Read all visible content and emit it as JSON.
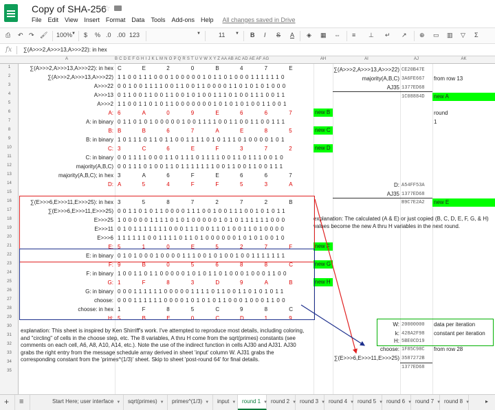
{
  "doc": {
    "title": "Copy of SHA-256",
    "saved_status": "All changes saved in Drive"
  },
  "menu": [
    "File",
    "Edit",
    "View",
    "Insert",
    "Format",
    "Data",
    "Tools",
    "Add-ons",
    "Help"
  ],
  "toolbar": {
    "zoom": "100%",
    "currency": "$",
    "percent": "%",
    "dec_less": ".0",
    "dec_more": ".00",
    "format_more": "123",
    "font_size": "11",
    "bold": "B",
    "italic": "I",
    "strike": "S",
    "text_color": "A"
  },
  "formula": "∑(A>>>2,A>>>13,A>>>22): in hex",
  "columns": {
    "A": "A",
    "cells": "B C D E F G H I J K L M N O P Q R S T U V W X Y Z AA AB AC AD AE AF AG",
    "AH": "AH",
    "AI": "AI",
    "AJ": "AJ",
    "AK": "AK"
  },
  "rows": [
    {
      "n": "1",
      "label": "∑(A>>>2,A>>>13,A>>>22): in hex",
      "hex": [
        "C",
        "",
        "E",
        "",
        "2",
        "",
        "0",
        "",
        "B",
        "",
        "4",
        "",
        "7",
        "",
        "E"
      ]
    },
    {
      "n": "2",
      "label": "∑(A>>>2,A>>>13,A>>>22)",
      "bits": "11001110001000001011010001111110"
    },
    {
      "n": "3",
      "label": "A>>>22",
      "bits": "00100111100110011000011010101000"
    },
    {
      "n": "4",
      "label": "A>>>13",
      "bits": "01100110011001010011101001110011"
    },
    {
      "n": "5",
      "label": "A>>>2",
      "bits": "11001101011000000010101010011001"
    },
    {
      "n": "6",
      "label": "A:",
      "red": true,
      "hex": [
        "6",
        "",
        "A",
        "",
        "0",
        "",
        "9",
        "",
        "E",
        "",
        "6",
        "",
        "6",
        "",
        "7"
      ]
    },
    {
      "n": "7",
      "label": "A: in binary",
      "bits": "01101010000010011110011001100111"
    },
    {
      "n": "8",
      "label": "B:",
      "red": true,
      "hex": [
        "B",
        "",
        "B",
        "",
        "6",
        "",
        "7",
        "",
        "A",
        "",
        "E",
        "",
        "8",
        "",
        "5"
      ]
    },
    {
      "n": "9",
      "label": "B: in binary",
      "bits": "10111011011001111010111010000101"
    },
    {
      "n": "10",
      "label": "C:",
      "red": true,
      "hex": [
        "3",
        "",
        "C",
        "",
        "6",
        "",
        "E",
        "",
        "F",
        "",
        "3",
        "",
        "7",
        "",
        "2"
      ]
    },
    {
      "n": "11",
      "label": "C: in binary",
      "bits": "00111100011011101111001101110010"
    },
    {
      "n": "12",
      "label": "majority(A,B,C)",
      "bits": "00111010011011111110011001100111"
    },
    {
      "n": "13",
      "label": "majority(A,B,C); in hex",
      "hex": [
        "3",
        "",
        "A",
        "",
        "6",
        "",
        "F",
        "",
        "E",
        "",
        "6",
        "",
        "6",
        "",
        "7"
      ]
    },
    {
      "n": "14",
      "label": "D:",
      "red": true,
      "hex": [
        "A",
        "",
        "5",
        "",
        "4",
        "",
        "F",
        "",
        "F",
        "",
        "5",
        "",
        "3",
        "",
        "A"
      ]
    },
    {
      "n": "15",
      "label": "",
      "bits": ""
    },
    {
      "n": "16",
      "label": "∑(E>>>6,E>>>11,E>>>25): in hex",
      "hex": [
        "3",
        "",
        "5",
        "",
        "8",
        "",
        "7",
        "",
        "2",
        "",
        "7",
        "",
        "2",
        "",
        "B"
      ]
    },
    {
      "n": "17",
      "label": "∑(E>>>6,E>>>11,E>>>25)",
      "bits": "00110101100001110010011100101011"
    },
    {
      "n": "18",
      "label": "E>>>25",
      "bits": "10000011110101000001010111111000"
    },
    {
      "n": "19",
      "label": "E>>>11",
      "bits": "01011111110001110011010011010000"
    },
    {
      "n": "20",
      "label": "E>>>6",
      "bits": "11111100111101101000000101010010"
    },
    {
      "n": "21",
      "label": "E:",
      "red": true,
      "hex": [
        "5",
        "",
        "1",
        "",
        "0",
        "",
        "E",
        "",
        "5",
        "",
        "2",
        "",
        "7",
        "",
        "F"
      ]
    },
    {
      "n": "22",
      "label": "E: in binary",
      "bits": "01010001000011100101001001111111"
    },
    {
      "n": "23",
      "label": "F:",
      "red": true,
      "hex": [
        "9",
        "",
        "B",
        "",
        "0",
        "",
        "5",
        "",
        "6",
        "",
        "8",
        "",
        "8",
        "",
        "C"
      ]
    },
    {
      "n": "24",
      "label": "F: in binary",
      "bits": "10011011000001010110100010001100"
    },
    {
      "n": "25",
      "label": "G:",
      "red": true,
      "hex": [
        "1",
        "",
        "F",
        "",
        "8",
        "",
        "3",
        "",
        "D",
        "",
        "9",
        "",
        "A",
        "",
        "B"
      ]
    },
    {
      "n": "26",
      "label": "G: in binary",
      "bits": "00011111100000111101100110101011"
    },
    {
      "n": "27",
      "label": "choose:",
      "bits": "00011111100001010101100010001100"
    },
    {
      "n": "28",
      "label": "choose: in hex",
      "hex": [
        "1",
        "",
        "F",
        "",
        "8",
        "",
        "5",
        "",
        "C",
        "",
        "9",
        "",
        "8",
        "",
        "C"
      ]
    },
    {
      "n": "29",
      "label": "H:",
      "red": true,
      "hex": [
        "5",
        "",
        "B",
        "",
        "E",
        "",
        "0",
        "",
        "C",
        "",
        "D",
        "",
        "1",
        "",
        "9"
      ]
    },
    {
      "n": "30",
      "label": "",
      "bits": ""
    },
    {
      "n": "31",
      "label": "",
      "bits": ""
    },
    {
      "n": "32",
      "label": "",
      "bits": ""
    },
    {
      "n": "33",
      "label": "",
      "bits": ""
    },
    {
      "n": "34",
      "label": "",
      "bits": ""
    },
    {
      "n": "35",
      "label": "",
      "bits": ""
    }
  ],
  "right": {
    "ai1": "∑(A>>>2,A>>>13,A>>>22)",
    "aj1": "CE20B47E",
    "ai2": "majority(A,B,C)",
    "aj2": "3A6FE667",
    "ak2": "from row 13",
    "ai3": "AJ35",
    "aj3": "1377ED68",
    "aj4": "1C08884D",
    "ak4": "new A",
    "ak6": "round",
    "ak7": "1",
    "ai14": "D:",
    "aj14": "A54FF53A",
    "ai15": "AJ35",
    "aj15": "1377ED68",
    "aj16": "B9C7E2A2",
    "ak16": "new E",
    "ah6": "new B",
    "ah8": "new C",
    "ah10": "new D",
    "ah21": "new F",
    "ah23": "new G",
    "ah25": "new H",
    "explanation2": "explanation:  The calculated (A & E) or just copied (B, C, D, E, F, G, & H) values become the new A thru H variables in the next round.",
    "w_lbl": "W:",
    "w_val": "20000000",
    "w_desc": "data per iteration",
    "k_lbl": "k:",
    "k_val": "428A2F98",
    "k_desc": "constant per iteration",
    "h_lbl": "H:",
    "h_val": "5BE0CD19",
    "choose_lbl": "choose:",
    "choose_val": "1F85C98C",
    "choose_desc": "from row 28",
    "sigma_lbl": "∑(E>>>6,E>>>11,E>>>25)",
    "sigma_val": "3587272B",
    "last_val": "1377ED68"
  },
  "explanation1": "explanation:  This sheet is inspired by Ken Shirriff's work.  I've attempted to reproduce most details, including coloring, and \"circling\" of cells in the choose step, etc.  The 8 variables, A thru H come from the sqrt(primes) constants (see comments on each cell, A6, A8, A10, A14, etc.).  Note the use of the indirect function in cells AJ30 and AJ31.  AJ30 grabs the right entry from the message schedule array derived in sheet 'input' column W.  AJ31 grabs the corresponding constant from the 'primes^(1/3)' sheet.  Skip to sheet 'post-round 64' for final details.",
  "tabs": [
    "Start Here; user interface",
    "sqrt(primes)",
    "primes^(1/3)",
    "input",
    "round 1",
    "round 2",
    "round 3",
    "round 4",
    "round 5",
    "round 6",
    "round 7",
    "round 8"
  ],
  "active_tab": "round 1",
  "colors": {
    "green": "#00ff00",
    "red_box": "#e02020",
    "blue_box": "#1c2e8c",
    "red_text": "#dd0000"
  }
}
